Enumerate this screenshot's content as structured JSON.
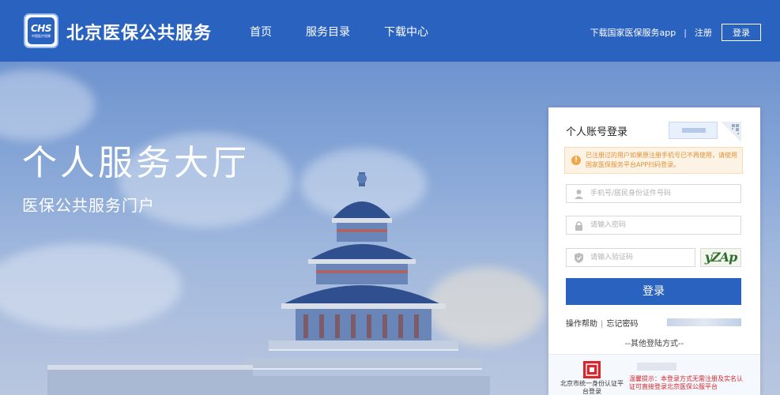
{
  "header": {
    "logo_mark": "CHS",
    "logo_sub": "中国医疗保障",
    "site_title": "北京医保公共服务",
    "nav": [
      {
        "label": "首页"
      },
      {
        "label": "服务目录"
      },
      {
        "label": "下载中心"
      }
    ],
    "app_download": "下载国家医保服务app",
    "separator": "|",
    "register": "注册",
    "login": "登录"
  },
  "hero": {
    "title": "个人服务大厅",
    "subtitle": "医保公共服务门户"
  },
  "login_panel": {
    "title": "个人账号登录",
    "notice": "已注册过的用户如果原注册手机号已不再使用，请使用国家医保服务平台APP扫码登录。",
    "notice_icon": "!",
    "account_placeholder": "手机号/居民身份证件号码",
    "password_placeholder": "请输入密码",
    "captcha_placeholder": "请输入验证码",
    "captcha_text": "yZAp",
    "submit": "登录",
    "help": "操作帮助",
    "link_sep": "|",
    "forgot": "忘记密码",
    "other_title": "--其他登陆方式--",
    "gov_login": "北京市统一身份认证平台登录",
    "warn": "温馨提示：本登录方式无需注册及实名认证可直接登录北京医保公服平台"
  },
  "colors": {
    "header_bg": "#2a62c0",
    "button_bg": "#2a62c0",
    "notice_text": "#e0913a",
    "warn_text": "#d4262c"
  },
  "icons": {
    "user": "user-icon",
    "lock": "lock-icon",
    "shield": "shield-icon",
    "qr": "qr-code-icon",
    "gov": "gov-emblem-icon",
    "notice": "alert-icon"
  }
}
